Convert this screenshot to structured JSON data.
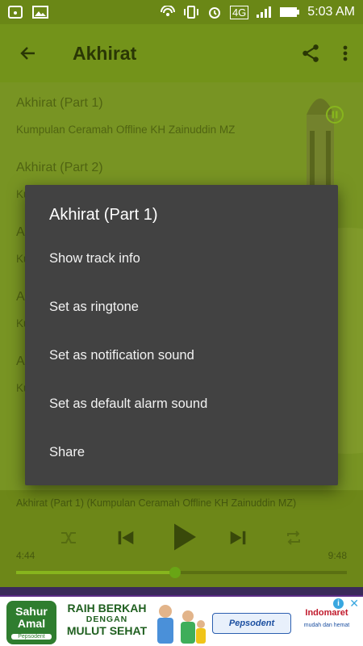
{
  "status_bar": {
    "network": "4G",
    "time": "5:03 AM"
  },
  "app_bar": {
    "title": "Akhirat",
    "back_icon": "arrow-back-icon",
    "share_icon": "share-icon",
    "more_icon": "more-vert-icon"
  },
  "tracks": [
    {
      "title": "Akhirat (Part 1)",
      "subtitle": "Kumpulan Ceramah Offline KH Zainuddin MZ"
    },
    {
      "title": "Akhirat (Part 2)",
      "subtitle": "Ku"
    },
    {
      "title": "A",
      "subtitle": "Ku"
    },
    {
      "title": "A",
      "subtitle": "Ku"
    },
    {
      "title": "A",
      "subtitle": "Ku"
    }
  ],
  "dialog": {
    "title": "Akhirat (Part 1)",
    "items": [
      "Show track info",
      "Set as ringtone",
      "Set as notification sound",
      "Set as default alarm sound",
      "Share"
    ]
  },
  "player": {
    "now_playing": "Akhirat (Part 1) (Kumpulan Ceramah Offline KH Zainuddin MZ)",
    "elapsed": "4:44",
    "duration": "9:48",
    "progress": 0.48
  },
  "ad": {
    "logo_text": "Sahur Amal",
    "logo_sub": "Pepsodent",
    "headline_1": "RAIH BERKAH",
    "headline_2": "DENGAN",
    "headline_3": "MULUT SEHAT",
    "brand_1": "Pepsodent",
    "brand_2": "Indomaret",
    "brand_2_tag": "mudah dan hemat"
  },
  "colors": {
    "accent": "#8fbf1f",
    "dialog_bg": "#424242",
    "app_bar": "#7a9b1c"
  }
}
